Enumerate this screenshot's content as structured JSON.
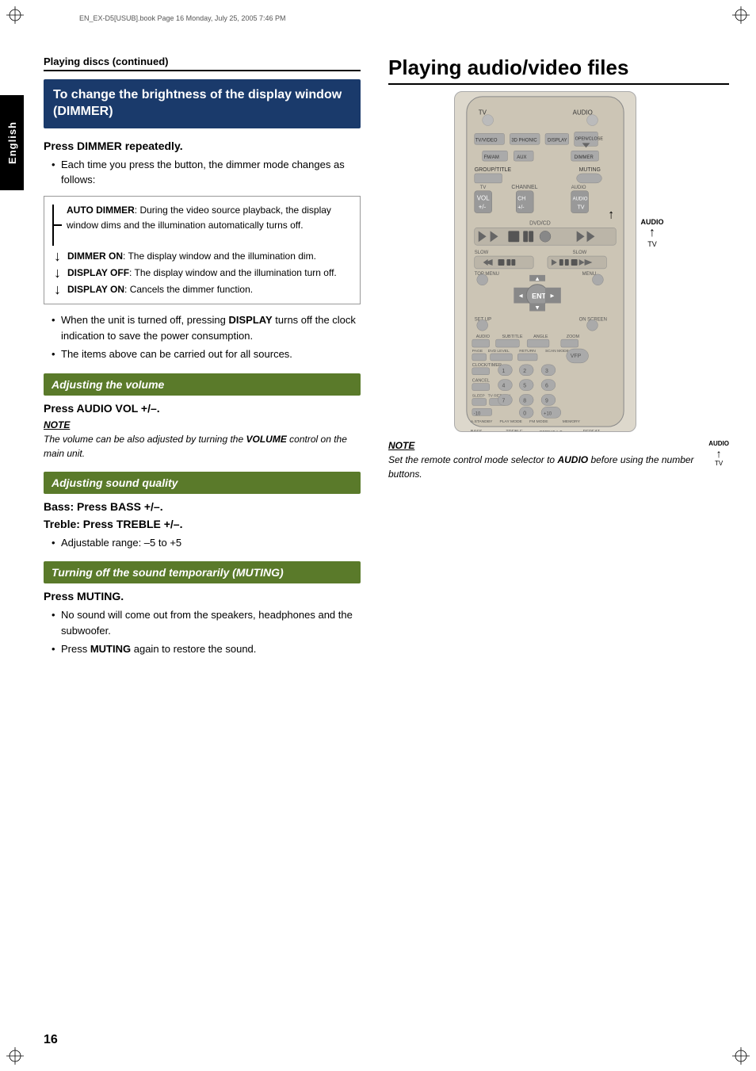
{
  "page": {
    "number": "16",
    "file_info": "EN_EX-D5[USUB].book  Page 16  Monday, July 25, 2005  7:46 PM"
  },
  "left_column": {
    "section_header": "Playing discs (continued)",
    "blue_box_title": "To change the brightness of the display window (DIMMER)",
    "press_heading": "Press DIMMER repeatedly.",
    "bullet1": "Each time you press the button, the dimmer mode changes as follows:",
    "auto_dimmer_label": "AUTO DIMMER",
    "auto_dimmer_text": ": During the video source playback, the display window dims and the illumination automatically turns off.",
    "dimmer_on_label": "DIMMER ON",
    "dimmer_on_text": ": The display window and the illumination dim.",
    "display_off_label": "DISPLAY OFF",
    "display_off_text": ": The display window and the illumination turn off.",
    "display_on_label": "DISPLAY ON",
    "display_on_text": ": Cancels the dimmer function.",
    "bullet2": "When the unit is turned off, pressing DISPLAY turns off the clock indication to save the power consumption.",
    "bullet3": "The items above can be carried out for all sources.",
    "adjusting_volume_bar": "Adjusting the volume",
    "press_audio_vol": "Press AUDIO VOL +/–.",
    "note_label": "NOTE",
    "note_text": "The volume can be also adjusted by turning the VOLUME control on the main unit.",
    "adjusting_sound_bar": "Adjusting sound quality",
    "bass_heading": "Bass: Press BASS +/–.",
    "treble_heading": "Treble: Press TREBLE +/–.",
    "adjustable_range": "Adjustable range: –5 to +5",
    "turning_off_bar": "Turning off the sound temporarily (MUTING)",
    "press_muting": "Press MUTING.",
    "muting_bullet1": "No sound will come out from the speakers, headphones and the subwoofer.",
    "muting_bullet2": "Press MUTING again to restore the sound."
  },
  "right_column": {
    "main_title": "Playing audio/video files",
    "note_label": "NOTE",
    "note_text": "Set the remote control mode selector to AUDIO before using the number buttons.",
    "audio_label": "AUDIO",
    "tv_label": "TV"
  },
  "sidebar": {
    "label": "English"
  }
}
